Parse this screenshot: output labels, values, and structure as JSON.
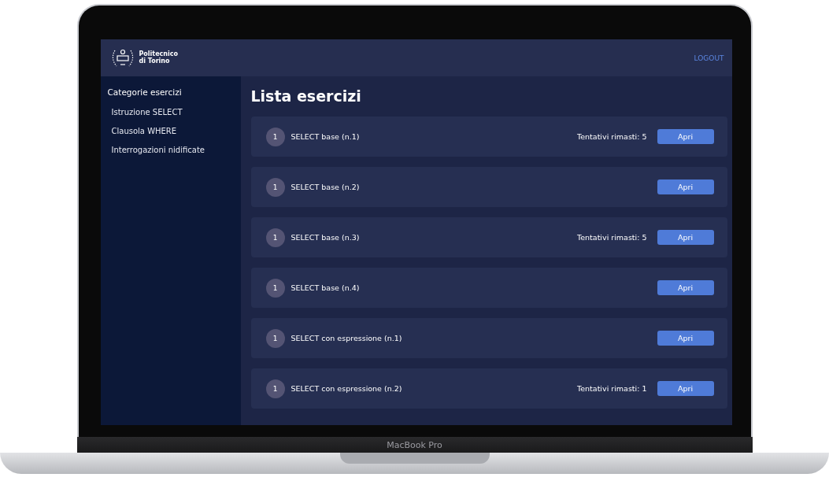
{
  "header": {
    "logo_lines": [
      "Politecnico",
      "di Torino"
    ],
    "logout": "LOGOUT"
  },
  "sidebar": {
    "title": "Categorie esercizi",
    "items": [
      "Istruzione SELECT",
      "Clausola WHERE",
      "Interrogazioni nidificate"
    ]
  },
  "main": {
    "title": "Lista esercizi",
    "exercises": [
      {
        "number": "1",
        "name": "SELECT base (n.1)",
        "attempts": "Tentativi rimasti: 5",
        "button": "Apri"
      },
      {
        "number": "1",
        "name": "SELECT base (n.2)",
        "button": "Apri"
      },
      {
        "number": "1",
        "name": "SELECT base (n.3)",
        "attempts": "Tentativi rimasti: 5",
        "button": "Apri"
      },
      {
        "number": "1",
        "name": "SELECT base (n.4)",
        "button": "Apri"
      },
      {
        "number": "1",
        "name": "SELECT con espressione (n.1)",
        "button": "Apri"
      },
      {
        "number": "1",
        "name": "SELECT con espressione (n.2)",
        "attempts": "Tentativi rimasti: 1",
        "button": "Apri"
      }
    ]
  },
  "laptop": {
    "label": "MacBook Pro"
  }
}
